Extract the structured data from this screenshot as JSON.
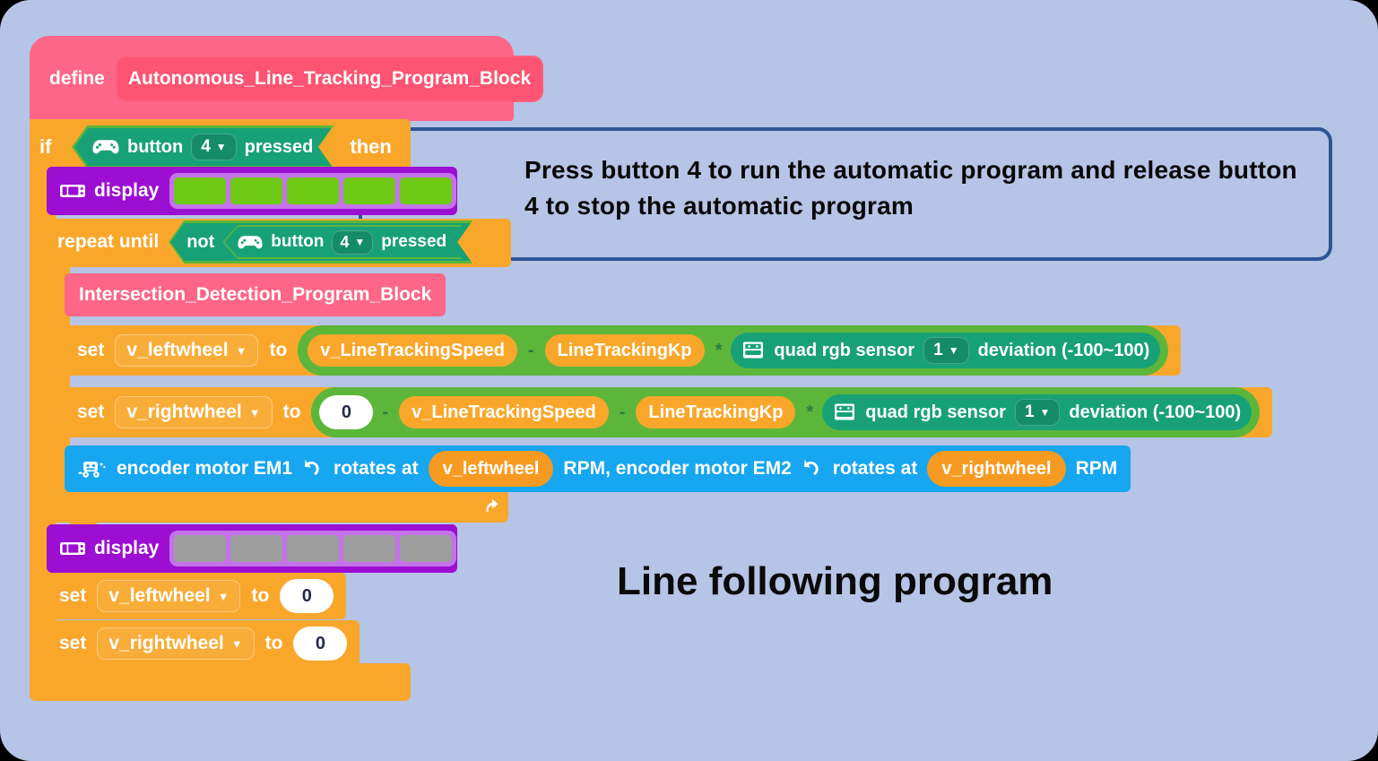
{
  "canvas": {
    "background": "#b6c4e6"
  },
  "define_block": {
    "keyword": "define",
    "name": "Autonomous_Line_Tracking_Program_Block",
    "color": "#fd6687"
  },
  "if_block": {
    "keyword": "if",
    "then": "then",
    "color": "#f9a72b",
    "condition": {
      "icon": "gamepad-icon",
      "label": "button",
      "dropdown_value": "4",
      "suffix": "pressed",
      "color": "#18a177"
    }
  },
  "display_on": {
    "label": "display",
    "icon": "display-icon",
    "color": "#9c0ed2",
    "led_color": "#6dc914",
    "led_count": 5
  },
  "display_off": {
    "label": "display",
    "icon": "display-icon",
    "color": "#9c0ed2",
    "led_color": "#9e9e9e",
    "led_count": 5
  },
  "repeat_until": {
    "keyword": "repeat until",
    "not": "not",
    "condition": {
      "icon": "gamepad-icon",
      "label": "button",
      "dropdown_value": "4",
      "suffix": "pressed"
    }
  },
  "call_block": {
    "name": "Intersection_Detection_Program_Block",
    "color": "#fd6687"
  },
  "set_left_speed": {
    "keyword": "set",
    "variable": "v_leftwheel",
    "to": "to",
    "expr": {
      "term1": "v_LineTrackingSpeed",
      "op1": "-",
      "term2": "LineTrackingKp",
      "op2": "*",
      "sensor_icon": "quad-rgb-sensor-icon",
      "sensor_label": "quad rgb sensor",
      "sensor_port": "1",
      "sensor_value": "deviation (-100~100)"
    }
  },
  "set_right_speed": {
    "keyword": "set",
    "variable": "v_rightwheel",
    "to": "to",
    "expr": {
      "term0": "0",
      "op0": "-",
      "term1": "v_LineTrackingSpeed",
      "op1": "-",
      "term2": "LineTrackingKp",
      "op2": "*",
      "sensor_icon": "quad-rgb-sensor-icon",
      "sensor_label": "quad rgb sensor",
      "sensor_port": "1",
      "sensor_value": "deviation (-100~100)"
    }
  },
  "motor_block": {
    "icon": "robot-motor-icon",
    "text1": "encoder motor EM1",
    "rotate_icon": "rotate-ccw-icon",
    "text2": "rotates at",
    "var1": "v_leftwheel",
    "text3": "RPM, encoder motor EM2",
    "rotate_icon2": "rotate-ccw-icon",
    "text4": "rotates at",
    "var2": "v_rightwheel",
    "text5": "RPM",
    "color": "#17a6f0"
  },
  "set_left_zero": {
    "keyword": "set",
    "variable": "v_leftwheel",
    "to": "to",
    "value": "0"
  },
  "set_right_zero": {
    "keyword": "set",
    "variable": "v_rightwheel",
    "to": "to",
    "value": "0"
  },
  "callout": {
    "text": "Press button 4 to run the automatic program and release button 4 to stop the automatic program",
    "border_color": "#2f5596"
  },
  "caption": {
    "text": "Line following program"
  }
}
